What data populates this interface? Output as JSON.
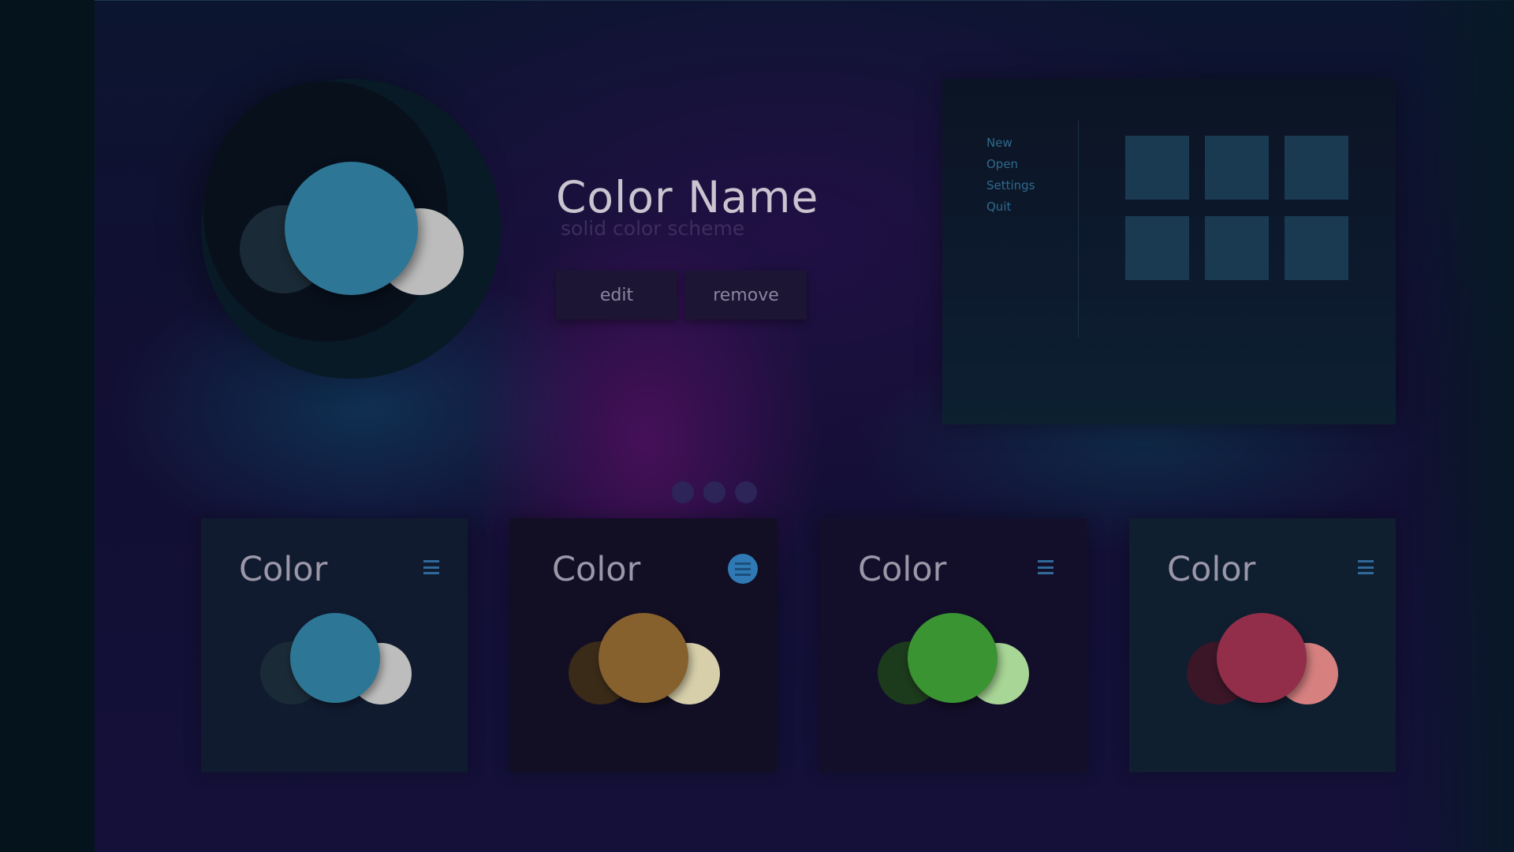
{
  "hero": {
    "title": "Color Name",
    "subtitle": "solid color scheme",
    "edit_label": "edit",
    "remove_label": "remove",
    "swatch": {
      "main": "#2e7696",
      "back": "#1a2a36",
      "side": "#bcbcbc"
    }
  },
  "menu": {
    "items": [
      "New",
      "Open",
      "Settings",
      "Quit"
    ],
    "tile_color": "#1a3a52"
  },
  "pager": {
    "active_index": 0,
    "count": 3
  },
  "cards": [
    {
      "title": "Color",
      "menu_icon": "hamburger-icon",
      "active": false,
      "bg": "#111b30",
      "main": "#2e7696",
      "back": "#1a2a36",
      "side": "#bdbdbd"
    },
    {
      "title": "Color",
      "menu_icon": "hamburger-icon",
      "active": true,
      "bg": "#120e24",
      "main": "#86612e",
      "back": "#3a2a18",
      "side": "#d7cfaa"
    },
    {
      "title": "Color",
      "menu_icon": "hamburger-icon",
      "active": false,
      "bg": "#130f2a",
      "main": "#3a9432",
      "back": "#1c3a1c",
      "side": "#a8d696"
    },
    {
      "title": "Color",
      "menu_icon": "hamburger-icon",
      "active": false,
      "bg": "#0f1f30",
      "main": "#922d4a",
      "back": "#3a1626",
      "side": "#d68080"
    }
  ]
}
